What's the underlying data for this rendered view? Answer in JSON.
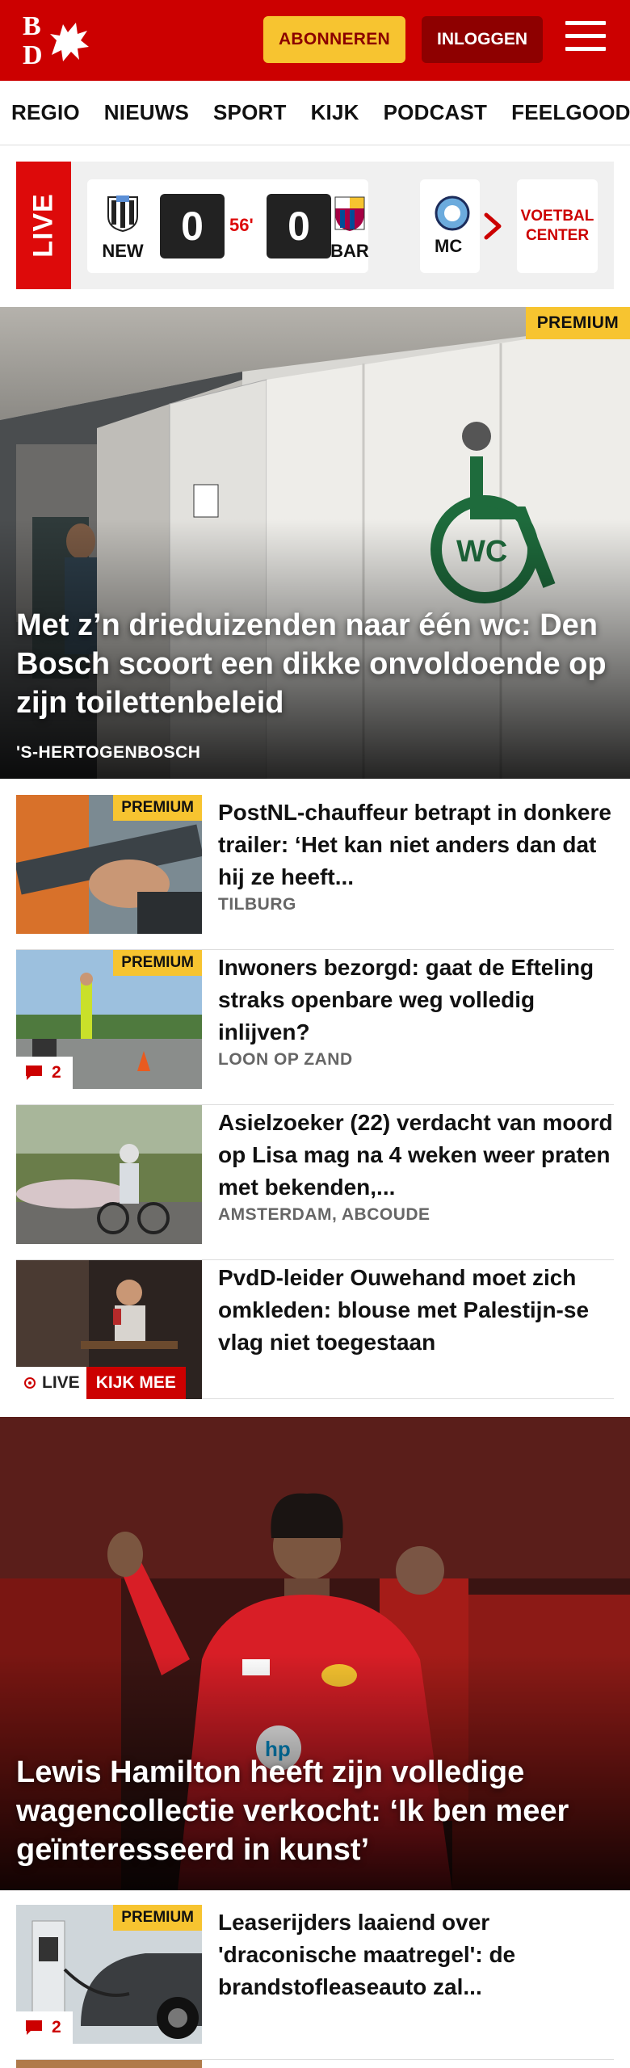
{
  "header": {
    "logo_top": "B",
    "logo_bottom": "D",
    "subscribe_label": "ABONNEREN",
    "login_label": "INLOGGEN"
  },
  "nav": {
    "items": [
      "REGIO",
      "NIEUWS",
      "SPORT",
      "KIJK",
      "PODCAST",
      "FEELGOOD"
    ]
  },
  "live": {
    "label": "LIVE",
    "match": {
      "home_team": "NEW",
      "away_team": "BAR",
      "home_score": "0",
      "away_score": "0",
      "minute": "56'"
    },
    "next_match_team": "MC",
    "voetbal_center_label": "VOETBAL CENTER"
  },
  "hero": {
    "badge": "PREMIUM",
    "title": "Met z’n drieduizenden naar één wc: Den Bosch scoort een dikke onvoldoende op zijn toilettenbeleid",
    "location": "'S-HERTOGENBOSCH"
  },
  "articles": [
    {
      "title": "PostNL-chauffeur betrapt in donkere trailer: ‘Het kan niet anders dan dat hij ze heeft...",
      "location": "TILBURG",
      "badge": "PREMIUM"
    },
    {
      "title": "Inwoners bezorgd: gaat de Efteling straks openbare weg volledig inlijven?",
      "location": "LOON OP ZAND",
      "badge": "PREMIUM",
      "comments": "2"
    },
    {
      "title": "Asielzoeker (22) verdacht van moord op Lisa mag na 4 weken weer praten met bekenden,...",
      "location": "AMSTERDAM, ABCOUDE"
    },
    {
      "title": "PvdD-leider Ouwehand moet zich omkleden: blouse met Palestijn-se vlag niet toegestaan",
      "live_label": "LIVE",
      "watch_label": "KIJK MEE"
    }
  ],
  "hero2": {
    "title": "Lewis Hamilton heeft zijn volledige wagencollectie verkocht: ‘Ik ben meer geïnteresseerd in kunst’"
  },
  "articles2": [
    {
      "title": "Leaserijders laaiend over 'draconische maatregel': de brandstofleaseauto zal...",
      "badge": "PREMIUM",
      "comments": "2"
    }
  ],
  "colors": {
    "brand_red": "#cc0000",
    "premium_yellow": "#f7c430",
    "login_dark_red": "#8e0000"
  }
}
